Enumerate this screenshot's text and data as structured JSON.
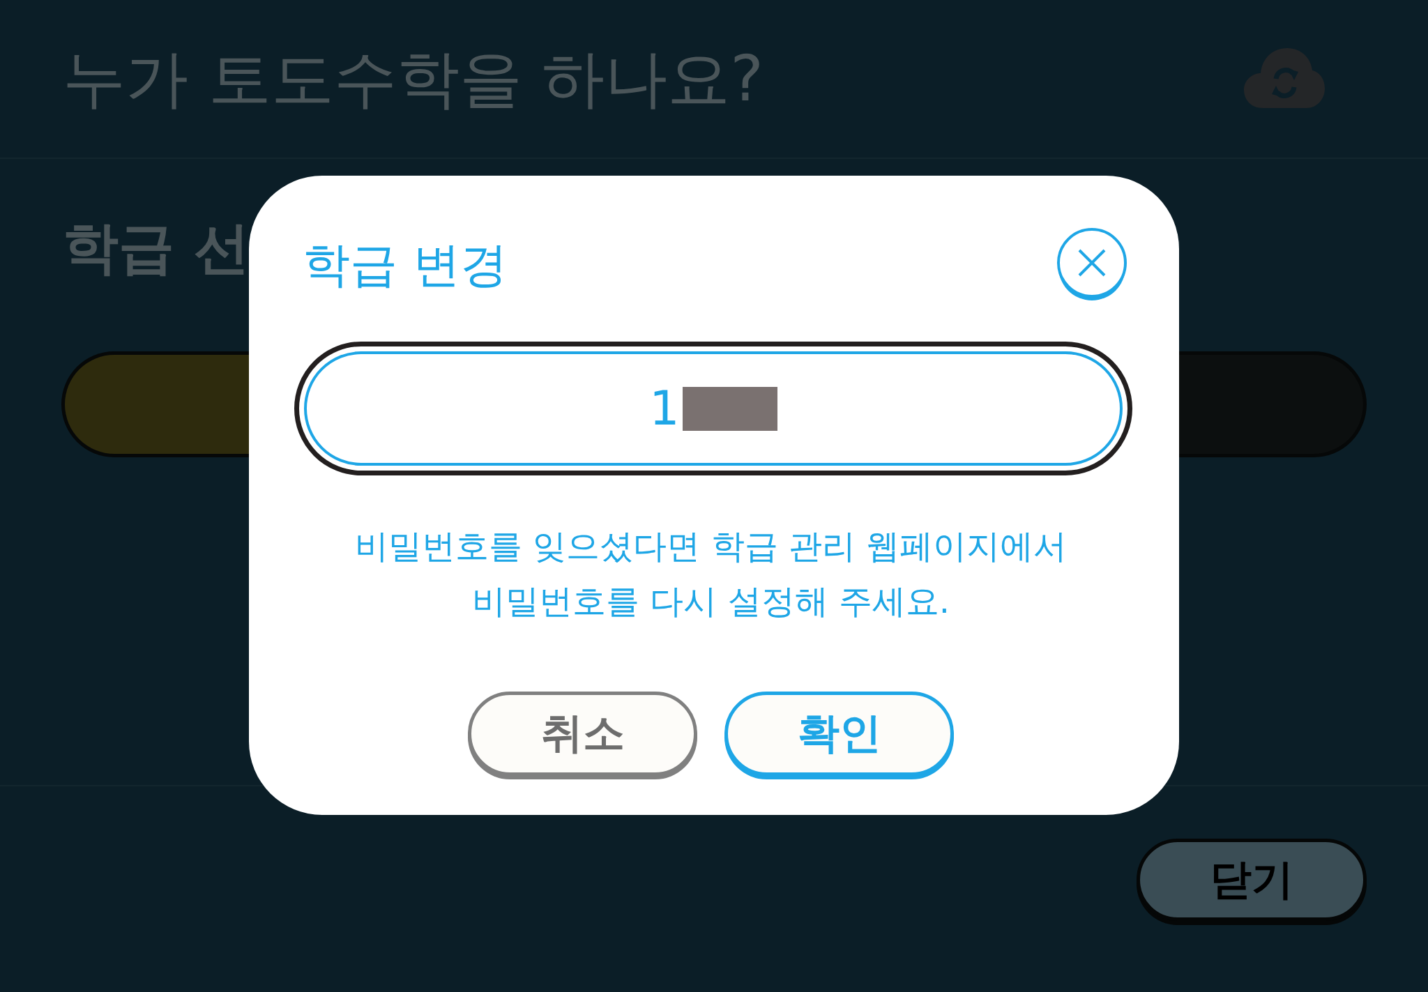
{
  "background": {
    "header": {
      "title": "누가 토도수학을 하나요?"
    },
    "section_title": "학급 선",
    "options": [
      {
        "color": "#2e2b0d"
      },
      {
        "color": "#0c0f0f"
      }
    ],
    "close_button": "닫기"
  },
  "dialog": {
    "title": "학급 변경",
    "field": {
      "value": "1",
      "masked": true
    },
    "message": "비밀번호를 잊으셨다면 학급 관리 웹페이지에서\n비밀번호를 다시 설정해 주세요.",
    "buttons": [
      {
        "label": "취소",
        "kind": "cancel"
      },
      {
        "label": "확인",
        "kind": "confirm"
      }
    ]
  }
}
